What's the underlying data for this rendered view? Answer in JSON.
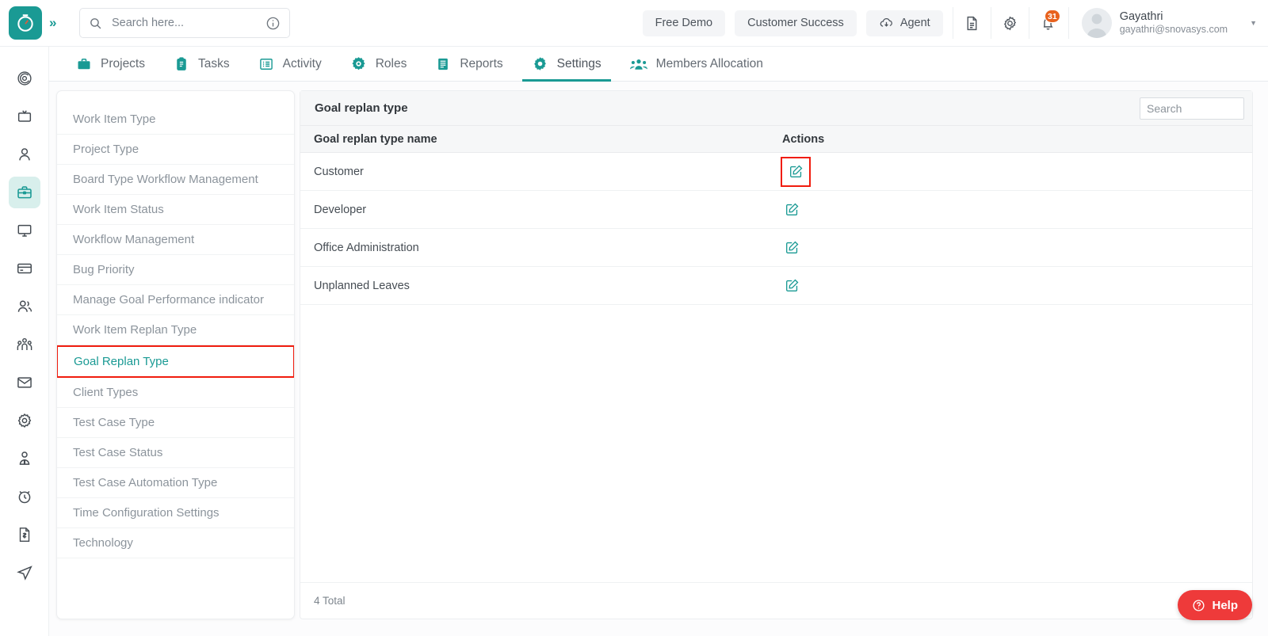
{
  "header": {
    "logo_icon": "clock-logo-icon",
    "expand_icon": "double-chevron-right-icon",
    "search": {
      "placeholder": "Search here...",
      "value": "",
      "icon": "search-icon",
      "info_icon": "info-circle-icon"
    },
    "pills": [
      {
        "label": "Free Demo",
        "icon": null,
        "name": "free-demo-button"
      },
      {
        "label": "Customer Success",
        "icon": null,
        "name": "customer-success-button"
      },
      {
        "label": "Agent",
        "icon": "cloud-download-icon",
        "name": "agent-button"
      }
    ],
    "icons": [
      {
        "name": "document-icon"
      },
      {
        "name": "gear-icon"
      }
    ],
    "notifications": {
      "icon": "bell-icon",
      "count": "31",
      "badge_color": "#e8621e"
    },
    "user": {
      "name": "Gayathri",
      "email": "gayathri@snovasys.com",
      "avatar_icon": "user-avatar-icon",
      "caret_icon": "chevron-down-icon"
    }
  },
  "nav": {
    "tabs": [
      {
        "label": "Projects",
        "icon": "briefcase-icon",
        "active": false
      },
      {
        "label": "Tasks",
        "icon": "clipboard-icon",
        "active": false
      },
      {
        "label": "Activity",
        "icon": "list-grid-icon",
        "active": false
      },
      {
        "label": "Roles",
        "icon": "target-gear-icon",
        "active": false
      },
      {
        "label": "Reports",
        "icon": "report-lines-icon",
        "active": false
      },
      {
        "label": "Settings",
        "icon": "gear-icon",
        "active": true
      },
      {
        "label": "Members Allocation",
        "icon": "people-group-icon",
        "active": false
      }
    ]
  },
  "rail": {
    "items": [
      {
        "name": "spiral-target-icon",
        "active": false
      },
      {
        "name": "tv-monitor-icon",
        "active": false
      },
      {
        "name": "person-icon",
        "active": false
      },
      {
        "name": "briefcase-icon",
        "active": true
      },
      {
        "name": "desktop-icon",
        "active": false
      },
      {
        "name": "credit-card-icon",
        "active": false
      },
      {
        "name": "two-people-icon",
        "active": false
      },
      {
        "name": "group-people-icon",
        "active": false
      },
      {
        "name": "mail-icon",
        "active": false
      },
      {
        "name": "gear-icon",
        "active": false
      },
      {
        "name": "user-tie-icon",
        "active": false
      },
      {
        "name": "alarm-clock-icon",
        "active": false
      },
      {
        "name": "invoice-dollar-icon",
        "active": false
      },
      {
        "name": "send-paper-plane-icon",
        "active": false
      }
    ]
  },
  "settings_menu": {
    "items": [
      {
        "label": "Work Item Type",
        "selected": false
      },
      {
        "label": "Project Type",
        "selected": false
      },
      {
        "label": "Board Type Workflow Management",
        "selected": false
      },
      {
        "label": "Work Item Status",
        "selected": false
      },
      {
        "label": "Workflow Management",
        "selected": false
      },
      {
        "label": "Bug Priority",
        "selected": false
      },
      {
        "label": "Manage Goal Performance indicator",
        "selected": false
      },
      {
        "label": "Work Item Replan Type",
        "selected": false
      },
      {
        "label": "Goal Replan Type",
        "selected": true
      },
      {
        "label": "Client Types",
        "selected": false
      },
      {
        "label": "Test Case Type",
        "selected": false
      },
      {
        "label": "Test Case Status",
        "selected": false
      },
      {
        "label": "Test Case Automation Type",
        "selected": false
      },
      {
        "label": "Time Configuration Settings",
        "selected": false
      },
      {
        "label": "Technology",
        "selected": false
      }
    ]
  },
  "main": {
    "panel_title": "Goal replan type",
    "search": {
      "placeholder": "Search",
      "value": ""
    },
    "columns": [
      "Goal replan type name",
      "Actions"
    ],
    "rows": [
      {
        "name": "Customer",
        "action_icon": "edit-pencil-icon",
        "highlighted": true
      },
      {
        "name": "Developer",
        "action_icon": "edit-pencil-icon",
        "highlighted": false
      },
      {
        "name": "Office Administration",
        "action_icon": "edit-pencil-icon",
        "highlighted": false
      },
      {
        "name": "Unplanned Leaves",
        "action_icon": "edit-pencil-icon",
        "highlighted": false
      }
    ],
    "footer_total": "4 Total"
  },
  "help": {
    "label": "Help",
    "icon": "question-circle-icon"
  },
  "colors": {
    "accent": "#1a9a94",
    "highlight": "#f01c0e",
    "badge": "#e8621e",
    "help": "#ee3a3a"
  }
}
